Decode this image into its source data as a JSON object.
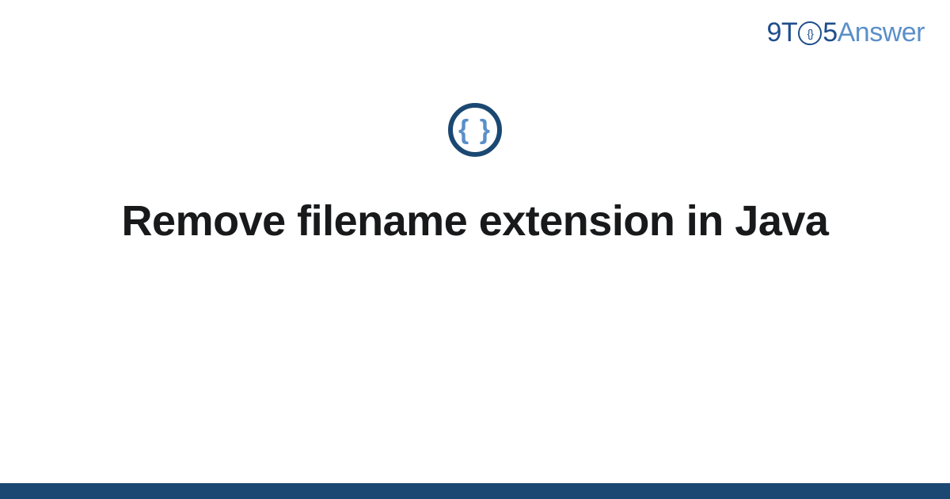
{
  "logo": {
    "part1": "9T",
    "part_clock": "{}",
    "part2": "5",
    "part3": "Answer"
  },
  "icon": {
    "braces": "{ }"
  },
  "title": "Remove filename extension in Java",
  "colors": {
    "dark_blue": "#1a4872",
    "light_blue": "#5a8fc9",
    "logo_blue": "#1e4e8c"
  }
}
